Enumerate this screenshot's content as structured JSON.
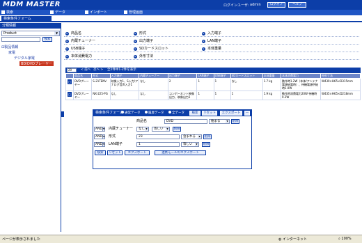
{
  "header": {
    "logo": "MDM MASTER",
    "login_label": "ログインユーザ:",
    "login_user": "admin",
    "buttons": [
      "ログオフ",
      "ヘルプ"
    ]
  },
  "menu": [
    "検索",
    "データ",
    "インポート",
    "管理画面"
  ],
  "tab": "検索条件フォーム",
  "sidebar": {
    "title": "分類情報",
    "select_value": "Product",
    "search_button": "検索",
    "tree": [
      "製品情報",
      "家電",
      "デジタル家電",
      "BD/DVDプレーヤー"
    ]
  },
  "attributes": [
    [
      "商品名",
      "形式",
      "入力端子"
    ],
    [
      "内蔵チューナー",
      "出力端子",
      "LAN端子"
    ],
    [
      "USB端子",
      "SDカードスロット",
      "本体重量"
    ],
    [
      "本体消費電力",
      "外形寸法",
      ""
    ]
  ],
  "results": {
    "page_size": "20",
    "nav": [
      "< 前へ",
      "次へ >",
      "全2件中1-2件を表示"
    ],
    "columns": [
      "商品名",
      "形式",
      "入力端子",
      "内蔵チューナー",
      "出力端子",
      "LAN端子",
      "USB端子",
      "SDカードスロット",
      "本体重量",
      "本体消費電力",
      "外形寸法"
    ],
    "rows": [
      {
        "check": "□",
        "cells": [
          "DVDプレーヤー",
          "S-21TENV",
          "映像入力1、S入力/アナログ音声入力1",
          "なし",
          "2",
          "1",
          "1",
          "なし",
          "1.7 kg",
          "動作時1.2W（本体/アンテナ電源給電時）、待機電源供給時1.0W",
          "W430×H65×D315mm"
        ]
      },
      {
        "check": "□",
        "cells": [
          "DVDプレーヤー",
          "NX-225-PG",
          "なし",
          "なし",
          "コンポーネント映像出力、映像出力1",
          "1",
          "1",
          "1",
          "1.9 kg",
          "動作時消費電力20W 待機時0.2W",
          "W435×H65×D218mm"
        ]
      }
    ]
  },
  "search_form": {
    "title": "検索条件フォーム",
    "radios": [
      "通常データ",
      "履歴データ",
      "全データ"
    ],
    "head_buttons": [
      "検索",
      "リセット",
      "エクスポート",
      "—"
    ],
    "rows": [
      {
        "and": "",
        "label": "商品名",
        "value": "DVD",
        "mode": "始まる",
        "del": "削除"
      },
      {
        "and": "AND",
        "label": "内蔵チューナー",
        "value": "なし",
        "mode": "等しい",
        "del": "削除"
      },
      {
        "and": "AND",
        "label": "形式",
        "value": "23",
        "mode": "含まれる",
        "del": "削除"
      },
      {
        "and": "AND",
        "label": "LAN端子",
        "value": "1",
        "mode": "等しい",
        "del": "削除"
      }
    ],
    "footer_buttons": [
      "検索",
      "リセット",
      "エクスポート",
      "連携モールのエクスポート"
    ]
  },
  "status": {
    "text": "ページが表示されました",
    "zone": "インターネット",
    "zoom": "100%"
  },
  "colors": {
    "primary": "#0c3ea8",
    "menubar": "#1f55c4",
    "table_header": "#6c85c8",
    "selected_tree": "#c9371f"
  }
}
